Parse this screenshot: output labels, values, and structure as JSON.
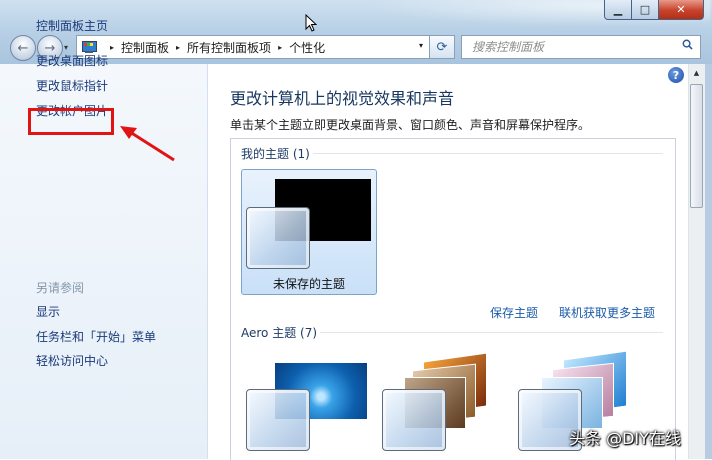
{
  "window": {
    "minimize": "▁",
    "maximize": "□",
    "close": "✕"
  },
  "nav": {
    "back_icon": "←",
    "forward_icon": "→",
    "history_icon": "▾"
  },
  "address": {
    "crumbs": [
      "控制面板",
      "所有控制面板项",
      "个性化"
    ],
    "separator": "▸",
    "dropdown_icon": "▾",
    "refresh_icon": "⟳"
  },
  "search": {
    "placeholder": "搜索控制面板"
  },
  "sidebar": {
    "home": "控制面板主页",
    "items": [
      {
        "label": "更改桌面图标"
      },
      {
        "label": "更改鼠标指针"
      },
      {
        "label": "更改帐户图片"
      }
    ],
    "see_also_title": "另请参阅",
    "see_also": [
      {
        "label": "显示"
      },
      {
        "label": "任务栏和「开始」菜单"
      },
      {
        "label": "轻松访问中心"
      }
    ]
  },
  "main": {
    "help_icon": "?",
    "title": "更改计算机上的视觉效果和声音",
    "description": "单击某个主题立即更改桌面背景、窗口颜色、声音和屏幕保护程序。",
    "my_themes": {
      "header": "我的主题 (1)",
      "items": [
        {
          "label": "未保存的主题"
        }
      ],
      "save_link": "保存主题",
      "online_link": "联机获取更多主题"
    },
    "aero_themes": {
      "header": "Aero 主题 (7)"
    }
  },
  "scrollbar": {
    "up_icon": "▲"
  },
  "watermark": "头条 @DIY在线",
  "colors": {
    "highlight_box": "#e11414",
    "link": "#1b3a7a",
    "title": "#17375e"
  }
}
